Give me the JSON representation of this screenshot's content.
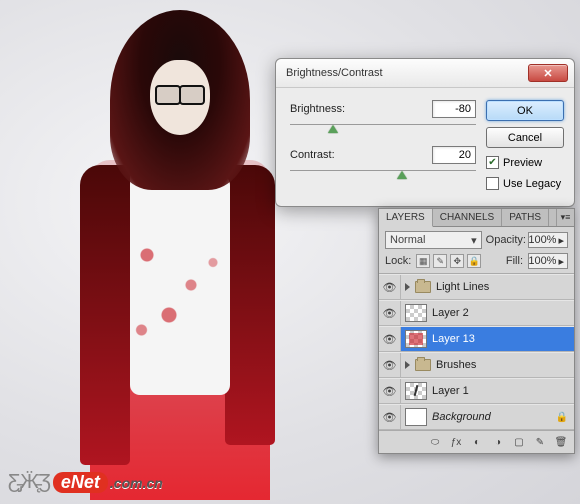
{
  "dialog": {
    "title": "Brightness/Contrast",
    "brightness_label": "Brightness:",
    "brightness_value": "-80",
    "contrast_label": "Contrast:",
    "contrast_value": "20",
    "ok_label": "OK",
    "cancel_label": "Cancel",
    "preview_label": "Preview",
    "preview_checked": true,
    "legacy_label": "Use Legacy",
    "legacy_checked": false
  },
  "layers_panel": {
    "tabs": [
      "LAYERS",
      "CHANNELS",
      "PATHS"
    ],
    "active_tab": "LAYERS",
    "blend_mode": "Normal",
    "opacity_label": "Opacity:",
    "opacity_value": "100%",
    "lock_label": "Lock:",
    "fill_label": "Fill:",
    "fill_value": "100%",
    "layers": [
      {
        "name": "Light Lines",
        "type": "group"
      },
      {
        "name": "Layer 2",
        "type": "layer"
      },
      {
        "name": "Layer 13",
        "type": "layer",
        "selected": true
      },
      {
        "name": "Brushes",
        "type": "group"
      },
      {
        "name": "Layer 1",
        "type": "layer"
      },
      {
        "name": "Background",
        "type": "bg"
      }
    ]
  },
  "watermark": {
    "e": "eNet",
    "rest": ".com.cn"
  }
}
